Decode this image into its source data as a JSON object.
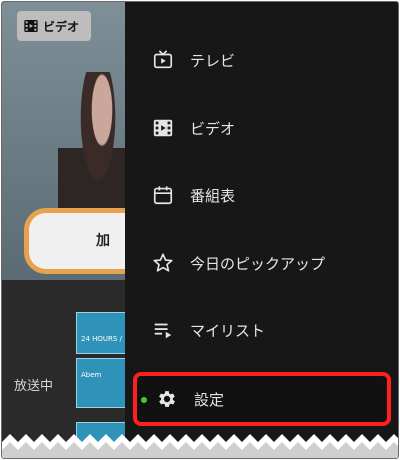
{
  "badge": {
    "label": "ビデオ"
  },
  "background": {
    "caption": "加",
    "section_label": "放送中",
    "thumb_text_1": "Abem",
    "thumb_text_2": "24 HOURS /"
  },
  "menu": {
    "items": [
      {
        "label": "テレビ",
        "icon": "tv-icon"
      },
      {
        "label": "ビデオ",
        "icon": "film-icon"
      },
      {
        "label": "番組表",
        "icon": "calendar-icon"
      },
      {
        "label": "今日のピックアップ",
        "icon": "star-icon"
      },
      {
        "label": "マイリスト",
        "icon": "playlist-icon"
      },
      {
        "label": "設定",
        "icon": "gear-icon",
        "active": true
      }
    ]
  },
  "colors": {
    "highlight_border": "#ff1f1f",
    "active_dot": "#3fd22c",
    "drawer_bg": "#171717"
  }
}
